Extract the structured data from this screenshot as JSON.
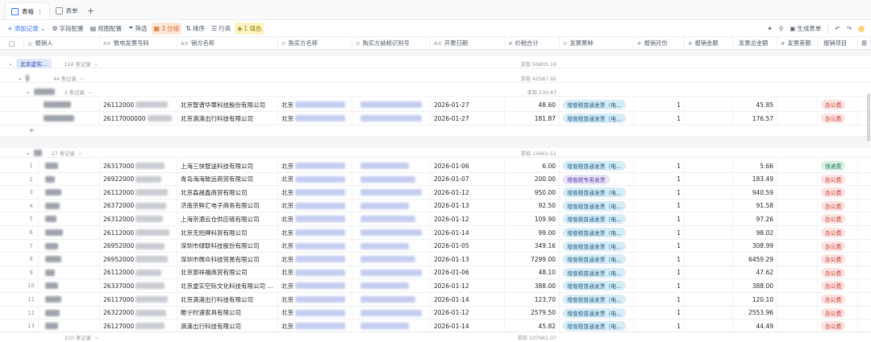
{
  "tabs": [
    {
      "label": "表格",
      "active": true
    },
    {
      "label": "表单",
      "active": false
    }
  ],
  "toolbar": {
    "add_record": "添加记录",
    "field_config": "字段配置",
    "view_config": "视图配置",
    "filter": "筛选",
    "group": "3 分组",
    "sort": "排序",
    "row_height": "行高",
    "fill_color": "1 填色",
    "generate_form": "生成表单"
  },
  "columns": [
    {
      "label": "报销人",
      "type": "Ⓐ"
    },
    {
      "label": "数电发票号码",
      "type": "A≡"
    },
    {
      "label": "销方名称",
      "type": "A≡"
    },
    {
      "label": "购买方名称",
      "type": "⊙"
    },
    {
      "label": "购买方纳税识别号",
      "type": "⊙"
    },
    {
      "label": "开票日期",
      "type": "A≡"
    },
    {
      "label": "价税合计",
      "type": "#"
    },
    {
      "label": "发票票种",
      "type": "⊙"
    },
    {
      "label": "报销月份",
      "type": "#"
    },
    {
      "label": "报销金额",
      "type": "#"
    },
    {
      "label": "发票总金额",
      "type": ""
    },
    {
      "label": "发票差额",
      "type": "#"
    },
    {
      "label": "报销项目",
      "type": ""
    },
    {
      "label": "是",
      "type": ""
    }
  ],
  "groups": {
    "g1": {
      "label": "北京虚实...",
      "count": "124 条记录",
      "sum": "求和 56805.19"
    },
    "g2": {
      "label": "",
      "count": "44 条记录",
      "sum": "求和 42587.92"
    },
    "g3": {
      "label": "",
      "count": "2 条记录",
      "sum": "求和 230.47"
    },
    "g4": {
      "label": "",
      "count": "27 条记录",
      "sum": "求和 15661.51"
    }
  },
  "group3_rows": [
    {
      "num": "",
      "invoice": "26112000",
      "seller": "北京智谱华章科技股份有限公司",
      "buyer": "北京",
      "date": "2026-01-27",
      "total": "48.60",
      "type": "增值税普通发票（电...",
      "month": "1",
      "invoice_total": "45.85",
      "project": "办公费"
    },
    {
      "num": "",
      "invoice": "26117000000",
      "seller": "北京滴滴出行科技有限公司",
      "buyer": "北京",
      "date": "2026-01-27",
      "total": "181.87",
      "type": "增值税普通发票（电...",
      "month": "1",
      "invoice_total": "176.57",
      "project": "办公费"
    }
  ],
  "group4_rows": [
    {
      "num": "1",
      "invoice": "26317000",
      "seller": "上海三快智送科技有限公司",
      "buyer": "北京",
      "date": "2026-01-06",
      "total": "6.00",
      "type": "增值税普通发票（电...",
      "month": "1",
      "invoice_total": "5.66",
      "project": "快递费"
    },
    {
      "num": "2",
      "invoice": "26922000",
      "seller": "青岛海海致远商贸有限公司",
      "buyer": "北京",
      "date": "2026-01-07",
      "total": "200.00",
      "type": "增值税专用发票",
      "month": "1",
      "invoice_total": "183.49",
      "project": "办公费"
    },
    {
      "num": "3",
      "invoice": "26112000",
      "seller": "北京森晟鑫商贸有限公司",
      "buyer": "北京",
      "date": "2026-01-12",
      "total": "950.00",
      "type": "增值税普通发票（电...",
      "month": "1",
      "invoice_total": "940.59",
      "project": "办公费"
    },
    {
      "num": "4",
      "invoice": "26372000",
      "seller": "济南京鲜汇电子商务有限公司",
      "buyer": "北京",
      "date": "2026-01-13",
      "total": "92.50",
      "type": "增值税普通发票（电...",
      "month": "1",
      "invoice_total": "91.58",
      "project": "办公费"
    },
    {
      "num": "5",
      "invoice": "26312000",
      "seller": "上海京酒云仓供应链有限公司",
      "buyer": "北京",
      "date": "2026-01-12",
      "total": "109.90",
      "type": "增值税普通发票（电...",
      "month": "1",
      "invoice_total": "97.26",
      "project": "办公费"
    },
    {
      "num": "6",
      "invoice": "26112000",
      "seller": "北京无招牌科贸有限公司",
      "buyer": "北京",
      "date": "2026-01-14",
      "total": "99.00",
      "type": "增值税普通发票（电...",
      "month": "1",
      "invoice_total": "98.02",
      "project": "办公费"
    },
    {
      "num": "7",
      "invoice": "26952000",
      "seller": "深圳市绿联科技股份有限公司",
      "buyer": "北京",
      "date": "2026-01-05",
      "total": "349.16",
      "type": "增值税普通发票（电...",
      "month": "1",
      "invoice_total": "308.99",
      "project": "办公费"
    },
    {
      "num": "8",
      "invoice": "26952000",
      "seller": "深圳市微众科技贸易有限公司",
      "buyer": "北京",
      "date": "2026-01-13",
      "total": "7299.00",
      "type": "增值税普通发票（电...",
      "month": "1",
      "invoice_total": "6459.29",
      "project": "办公费"
    },
    {
      "num": "9",
      "invoice": "26112000",
      "seller": "北京郭祥福商贸有限公司",
      "buyer": "北京",
      "date": "2026-01-06",
      "total": "48.10",
      "type": "增值税普通发票（电...",
      "month": "1",
      "invoice_total": "47.62",
      "project": "办公费"
    },
    {
      "num": "10",
      "invoice": "26337000",
      "seller": "北京虚实空际文化科技有限公司 ...",
      "buyer": "北京",
      "date": "2026-01-12",
      "total": "388.00",
      "type": "增值税普通发票（电...",
      "month": "1",
      "invoice_total": "388.00",
      "project": "办公费"
    },
    {
      "num": "11",
      "invoice": "26117000",
      "seller": "北京滴滴出行科技有限公司",
      "buyer": "北京",
      "date": "2026-01-14",
      "total": "123.70",
      "type": "增值税普通发票（电...",
      "month": "1",
      "invoice_total": "120.10",
      "project": "办公费"
    },
    {
      "num": "12",
      "invoice": "26322000",
      "seller": "睢宁时速家具有限公司",
      "buyer": "北京",
      "date": "2026-01-12",
      "total": "2579.50",
      "type": "增值税普通发票（电...",
      "month": "1",
      "invoice_total": "2553.96",
      "project": "办公费"
    },
    {
      "num": "13",
      "invoice": "26127000",
      "seller": "滴滴出行科技有限公司",
      "buyer": "北京",
      "date": "2026-01-14",
      "total": "45.82",
      "type": "增值税普通发票（电...",
      "month": "1",
      "invoice_total": "44.49",
      "project": "办公费"
    }
  ],
  "footer": {
    "count": "210 条记录",
    "sum": "求和 107661.07"
  },
  "colors": {
    "accent": "#3370ff",
    "group_orange": "#d4622a",
    "fill_yellow": "#a07a00",
    "project_red": "#c0392b"
  }
}
